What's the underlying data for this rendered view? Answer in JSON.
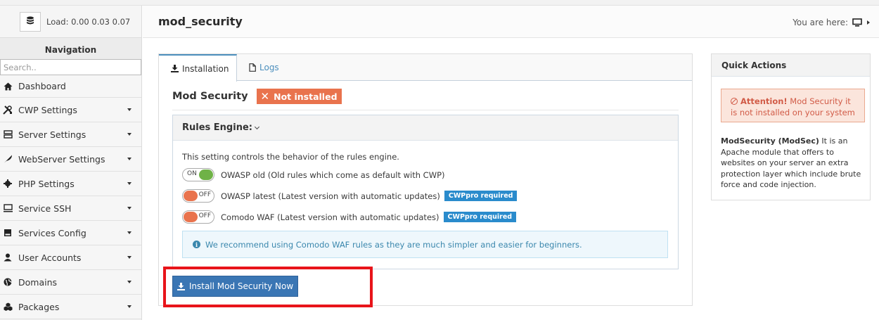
{
  "header": {
    "load_label": "Load: 0.00  0.03  0.07",
    "page_title": "mod_security",
    "breadcrumb_label": "You are here:"
  },
  "sidebar": {
    "title": "Navigation",
    "search_placeholder": "Search..",
    "items": [
      {
        "label": "Dashboard",
        "icon": "home-icon",
        "arrow": false
      },
      {
        "label": "CWP Settings",
        "icon": "tools-icon",
        "arrow": true
      },
      {
        "label": "Server Settings",
        "icon": "server-icon",
        "arrow": true
      },
      {
        "label": "WebServer Settings",
        "icon": "feather-icon",
        "arrow": true
      },
      {
        "label": "PHP Settings",
        "icon": "cog-icon",
        "arrow": true
      },
      {
        "label": "Service SSH",
        "icon": "monitor-icon",
        "arrow": true
      },
      {
        "label": "Services Config",
        "icon": "hdd-icon",
        "arrow": true
      },
      {
        "label": "User Accounts",
        "icon": "user-icon",
        "arrow": true
      },
      {
        "label": "Domains",
        "icon": "globe-icon",
        "arrow": true
      },
      {
        "label": "Packages",
        "icon": "cubes-icon",
        "arrow": true
      }
    ]
  },
  "tabs": [
    {
      "label": "Installation",
      "icon": "download-icon",
      "active": true
    },
    {
      "label": "Logs",
      "icon": "file-icon",
      "active": false
    }
  ],
  "module": {
    "title": "Mod Security",
    "status": "Not installed",
    "status_color": "#e9734d"
  },
  "rules_engine": {
    "title": "Rules Engine:",
    "description": "This setting controls the behavior of the rules engine.",
    "options": [
      {
        "state": "ON",
        "label": "OWASP old (Old rules which come as default with CWP)",
        "badge": ""
      },
      {
        "state": "OFF",
        "label": "OWASP latest (Latest version with automatic updates)",
        "badge": "CWPpro required"
      },
      {
        "state": "OFF",
        "label": "Comodo WAF (Latest version with automatic updates)",
        "badge": "CWPpro required"
      }
    ],
    "info": "We recommend using Comodo WAF rules as they are much simpler and easier for beginners."
  },
  "install_button": "Install Mod Security Now",
  "quick_actions": {
    "title": "Quick Actions",
    "alert_strong": "Attention!",
    "alert_text": " Mod Security it is not installed on your system",
    "desc_strong": "ModSecurity (ModSec)",
    "desc_text": " It is an Apache module that offers to websites on your server an extra protection layer which include brute force and code injection."
  },
  "colors": {
    "accent": "#3a76b4",
    "highlight": "#e8141a",
    "toggle_on": "#6fb247",
    "toggle_off": "#e9734d",
    "badge_pro": "#2a8bcc"
  }
}
